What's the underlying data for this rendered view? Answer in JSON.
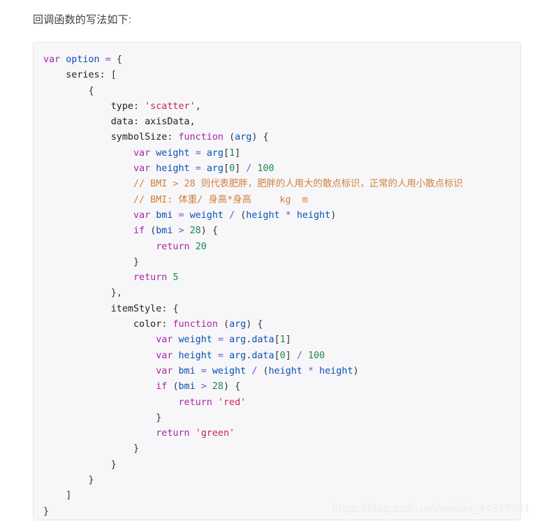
{
  "page": {
    "intro_text": "回调函数的写法如下:",
    "background_color": "#ffffff"
  },
  "code_block": {
    "language": "javascript",
    "background_color": "#f7f7f9",
    "border_color": "#e6e6ea",
    "colors": {
      "keyword": "#a626a4",
      "identifier": "#0b4fb5",
      "property": "#1f1f1f",
      "string": "#c7254e",
      "number": "#1a8a4c",
      "comment": "#d2813a",
      "operator": "#6a5acd",
      "plain": "#1f1f1f"
    },
    "lines": [
      {
        "indent": 0,
        "tokens": [
          {
            "t": "var",
            "c": "kw"
          },
          {
            "t": " ",
            "c": "plain"
          },
          {
            "t": "option",
            "c": "ident"
          },
          {
            "t": " ",
            "c": "plain"
          },
          {
            "t": "=",
            "c": "op"
          },
          {
            "t": " ",
            "c": "plain"
          },
          {
            "t": "{",
            "c": "punct"
          }
        ]
      },
      {
        "indent": 1,
        "tokens": [
          {
            "t": "series",
            "c": "prop"
          },
          {
            "t": ": ",
            "c": "punct"
          },
          {
            "t": "[",
            "c": "punct"
          }
        ]
      },
      {
        "indent": 2,
        "tokens": [
          {
            "t": "{",
            "c": "punct"
          }
        ]
      },
      {
        "indent": 3,
        "tokens": [
          {
            "t": "type",
            "c": "prop"
          },
          {
            "t": ": ",
            "c": "punct"
          },
          {
            "t": "'scatter'",
            "c": "str"
          },
          {
            "t": ",",
            "c": "punct"
          }
        ]
      },
      {
        "indent": 3,
        "tokens": [
          {
            "t": "data",
            "c": "prop"
          },
          {
            "t": ": ",
            "c": "punct"
          },
          {
            "t": "axisData",
            "c": "plain"
          },
          {
            "t": ",",
            "c": "punct"
          }
        ]
      },
      {
        "indent": 3,
        "tokens": [
          {
            "t": "symbolSize",
            "c": "prop"
          },
          {
            "t": ": ",
            "c": "punct"
          },
          {
            "t": "function",
            "c": "kw"
          },
          {
            "t": " ",
            "c": "plain"
          },
          {
            "t": "(",
            "c": "punct"
          },
          {
            "t": "arg",
            "c": "ident"
          },
          {
            "t": ")",
            "c": "punct"
          },
          {
            "t": " ",
            "c": "plain"
          },
          {
            "t": "{",
            "c": "punct"
          }
        ]
      },
      {
        "indent": 4,
        "tokens": [
          {
            "t": "var",
            "c": "kw"
          },
          {
            "t": " ",
            "c": "plain"
          },
          {
            "t": "weight",
            "c": "ident"
          },
          {
            "t": " ",
            "c": "plain"
          },
          {
            "t": "=",
            "c": "op"
          },
          {
            "t": " ",
            "c": "plain"
          },
          {
            "t": "arg",
            "c": "ident"
          },
          {
            "t": "[",
            "c": "punct"
          },
          {
            "t": "1",
            "c": "num"
          },
          {
            "t": "]",
            "c": "punct"
          }
        ]
      },
      {
        "indent": 4,
        "tokens": [
          {
            "t": "var",
            "c": "kw"
          },
          {
            "t": " ",
            "c": "plain"
          },
          {
            "t": "height",
            "c": "ident"
          },
          {
            "t": " ",
            "c": "plain"
          },
          {
            "t": "=",
            "c": "op"
          },
          {
            "t": " ",
            "c": "plain"
          },
          {
            "t": "arg",
            "c": "ident"
          },
          {
            "t": "[",
            "c": "punct"
          },
          {
            "t": "0",
            "c": "num"
          },
          {
            "t": "]",
            "c": "punct"
          },
          {
            "t": " ",
            "c": "plain"
          },
          {
            "t": "/",
            "c": "op"
          },
          {
            "t": " ",
            "c": "plain"
          },
          {
            "t": "100",
            "c": "num"
          }
        ]
      },
      {
        "indent": 4,
        "tokens": [
          {
            "t": "// BMI > 28 则代表肥胖，肥胖的人用大的散点标识，正常的人用小散点标识",
            "c": "comment"
          }
        ]
      },
      {
        "indent": 4,
        "tokens": [
          {
            "t": "// BMI: 体重/ 身高*身高     kg  m",
            "c": "comment"
          }
        ]
      },
      {
        "indent": 4,
        "tokens": [
          {
            "t": "var",
            "c": "kw"
          },
          {
            "t": " ",
            "c": "plain"
          },
          {
            "t": "bmi",
            "c": "ident"
          },
          {
            "t": " ",
            "c": "plain"
          },
          {
            "t": "=",
            "c": "op"
          },
          {
            "t": " ",
            "c": "plain"
          },
          {
            "t": "weight",
            "c": "ident"
          },
          {
            "t": " ",
            "c": "plain"
          },
          {
            "t": "/",
            "c": "op"
          },
          {
            "t": " ",
            "c": "plain"
          },
          {
            "t": "(",
            "c": "punct"
          },
          {
            "t": "height",
            "c": "ident"
          },
          {
            "t": " ",
            "c": "plain"
          },
          {
            "t": "*",
            "c": "op"
          },
          {
            "t": " ",
            "c": "plain"
          },
          {
            "t": "height",
            "c": "ident"
          },
          {
            "t": ")",
            "c": "punct"
          }
        ]
      },
      {
        "indent": 4,
        "tokens": [
          {
            "t": "if",
            "c": "kw"
          },
          {
            "t": " ",
            "c": "plain"
          },
          {
            "t": "(",
            "c": "punct"
          },
          {
            "t": "bmi",
            "c": "ident"
          },
          {
            "t": " ",
            "c": "plain"
          },
          {
            "t": ">",
            "c": "op"
          },
          {
            "t": " ",
            "c": "plain"
          },
          {
            "t": "28",
            "c": "num"
          },
          {
            "t": ")",
            "c": "punct"
          },
          {
            "t": " ",
            "c": "plain"
          },
          {
            "t": "{",
            "c": "punct"
          }
        ]
      },
      {
        "indent": 5,
        "tokens": [
          {
            "t": "return",
            "c": "kw"
          },
          {
            "t": " ",
            "c": "plain"
          },
          {
            "t": "20",
            "c": "num"
          }
        ]
      },
      {
        "indent": 4,
        "tokens": [
          {
            "t": "}",
            "c": "punct"
          }
        ]
      },
      {
        "indent": 4,
        "tokens": [
          {
            "t": "return",
            "c": "kw"
          },
          {
            "t": " ",
            "c": "plain"
          },
          {
            "t": "5",
            "c": "num"
          }
        ]
      },
      {
        "indent": 3,
        "tokens": [
          {
            "t": "}",
            "c": "punct"
          },
          {
            "t": ",",
            "c": "punct"
          }
        ]
      },
      {
        "indent": 3,
        "tokens": [
          {
            "t": "itemStyle",
            "c": "prop"
          },
          {
            "t": ": ",
            "c": "punct"
          },
          {
            "t": "{",
            "c": "punct"
          }
        ]
      },
      {
        "indent": 4,
        "tokens": [
          {
            "t": "color",
            "c": "prop"
          },
          {
            "t": ": ",
            "c": "punct"
          },
          {
            "t": "function",
            "c": "kw"
          },
          {
            "t": " ",
            "c": "plain"
          },
          {
            "t": "(",
            "c": "punct"
          },
          {
            "t": "arg",
            "c": "ident"
          },
          {
            "t": ")",
            "c": "punct"
          },
          {
            "t": " ",
            "c": "plain"
          },
          {
            "t": "{",
            "c": "punct"
          }
        ]
      },
      {
        "indent": 5,
        "tokens": [
          {
            "t": "var",
            "c": "kw"
          },
          {
            "t": " ",
            "c": "plain"
          },
          {
            "t": "weight",
            "c": "ident"
          },
          {
            "t": " ",
            "c": "plain"
          },
          {
            "t": "=",
            "c": "op"
          },
          {
            "t": " ",
            "c": "plain"
          },
          {
            "t": "arg",
            "c": "ident"
          },
          {
            "t": ".",
            "c": "punct"
          },
          {
            "t": "data",
            "c": "ident"
          },
          {
            "t": "[",
            "c": "punct"
          },
          {
            "t": "1",
            "c": "num"
          },
          {
            "t": "]",
            "c": "punct"
          }
        ]
      },
      {
        "indent": 5,
        "tokens": [
          {
            "t": "var",
            "c": "kw"
          },
          {
            "t": " ",
            "c": "plain"
          },
          {
            "t": "height",
            "c": "ident"
          },
          {
            "t": " ",
            "c": "plain"
          },
          {
            "t": "=",
            "c": "op"
          },
          {
            "t": " ",
            "c": "plain"
          },
          {
            "t": "arg",
            "c": "ident"
          },
          {
            "t": ".",
            "c": "punct"
          },
          {
            "t": "data",
            "c": "ident"
          },
          {
            "t": "[",
            "c": "punct"
          },
          {
            "t": "0",
            "c": "num"
          },
          {
            "t": "]",
            "c": "punct"
          },
          {
            "t": " ",
            "c": "plain"
          },
          {
            "t": "/",
            "c": "op"
          },
          {
            "t": " ",
            "c": "plain"
          },
          {
            "t": "100",
            "c": "num"
          }
        ]
      },
      {
        "indent": 5,
        "tokens": [
          {
            "t": "var",
            "c": "kw"
          },
          {
            "t": " ",
            "c": "plain"
          },
          {
            "t": "bmi",
            "c": "ident"
          },
          {
            "t": " ",
            "c": "plain"
          },
          {
            "t": "=",
            "c": "op"
          },
          {
            "t": " ",
            "c": "plain"
          },
          {
            "t": "weight",
            "c": "ident"
          },
          {
            "t": " ",
            "c": "plain"
          },
          {
            "t": "/",
            "c": "op"
          },
          {
            "t": " ",
            "c": "plain"
          },
          {
            "t": "(",
            "c": "punct"
          },
          {
            "t": "height",
            "c": "ident"
          },
          {
            "t": " ",
            "c": "plain"
          },
          {
            "t": "*",
            "c": "op"
          },
          {
            "t": " ",
            "c": "plain"
          },
          {
            "t": "height",
            "c": "ident"
          },
          {
            "t": ")",
            "c": "punct"
          }
        ]
      },
      {
        "indent": 5,
        "tokens": [
          {
            "t": "if",
            "c": "kw"
          },
          {
            "t": " ",
            "c": "plain"
          },
          {
            "t": "(",
            "c": "punct"
          },
          {
            "t": "bmi",
            "c": "ident"
          },
          {
            "t": " ",
            "c": "plain"
          },
          {
            "t": ">",
            "c": "op"
          },
          {
            "t": " ",
            "c": "plain"
          },
          {
            "t": "28",
            "c": "num"
          },
          {
            "t": ")",
            "c": "punct"
          },
          {
            "t": " ",
            "c": "plain"
          },
          {
            "t": "{",
            "c": "punct"
          }
        ]
      },
      {
        "indent": 6,
        "tokens": [
          {
            "t": "return",
            "c": "kw"
          },
          {
            "t": " ",
            "c": "plain"
          },
          {
            "t": "'red'",
            "c": "str"
          }
        ]
      },
      {
        "indent": 5,
        "tokens": [
          {
            "t": "}",
            "c": "punct"
          }
        ]
      },
      {
        "indent": 5,
        "tokens": [
          {
            "t": "return",
            "c": "kw"
          },
          {
            "t": " ",
            "c": "plain"
          },
          {
            "t": "'green'",
            "c": "str"
          }
        ]
      },
      {
        "indent": 4,
        "tokens": [
          {
            "t": "}",
            "c": "punct"
          }
        ]
      },
      {
        "indent": 3,
        "tokens": [
          {
            "t": "}",
            "c": "punct"
          }
        ]
      },
      {
        "indent": 2,
        "tokens": [
          {
            "t": "}",
            "c": "punct"
          }
        ]
      },
      {
        "indent": 1,
        "tokens": [
          {
            "t": "]",
            "c": "punct"
          }
        ]
      },
      {
        "indent": 0,
        "tokens": [
          {
            "t": "}",
            "c": "punct"
          }
        ]
      }
    ]
  },
  "watermark": {
    "text": "https://blog.csdn.net/weixin_44517301"
  }
}
